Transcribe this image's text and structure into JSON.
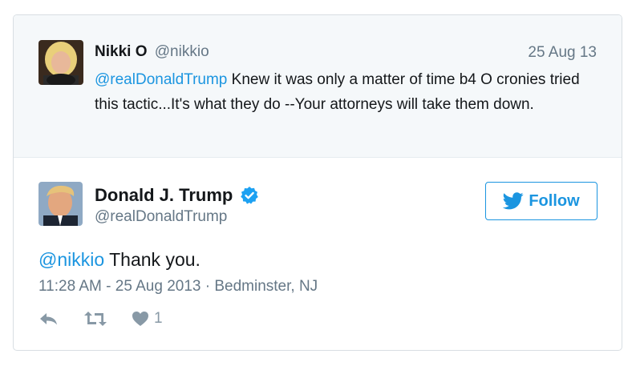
{
  "parent_tweet": {
    "name": "Nikki O",
    "handle": "@nikkio",
    "date": "25 Aug 13",
    "mention": "@realDonaldTrump",
    "text": " Knew it was only a matter of time b4 O cronies tried this tactic...It's what they do --Your attorneys will take them down.",
    "avatar_icon": "avatar-photo"
  },
  "tweet": {
    "author_name": "Donald J. Trump",
    "author_handle": "@realDonaldTrump",
    "verified_icon": "verified-badge-icon",
    "follow_label": "Follow",
    "mention": "@nikkio",
    "text": " Thank you.",
    "meta": "11:28 AM - 25 Aug 2013 · Bedminster, NJ",
    "like_count": "1"
  },
  "colors": {
    "accent": "#1b95e0",
    "secondary_text": "#657786",
    "parent_bg": "#f5f8fa"
  }
}
